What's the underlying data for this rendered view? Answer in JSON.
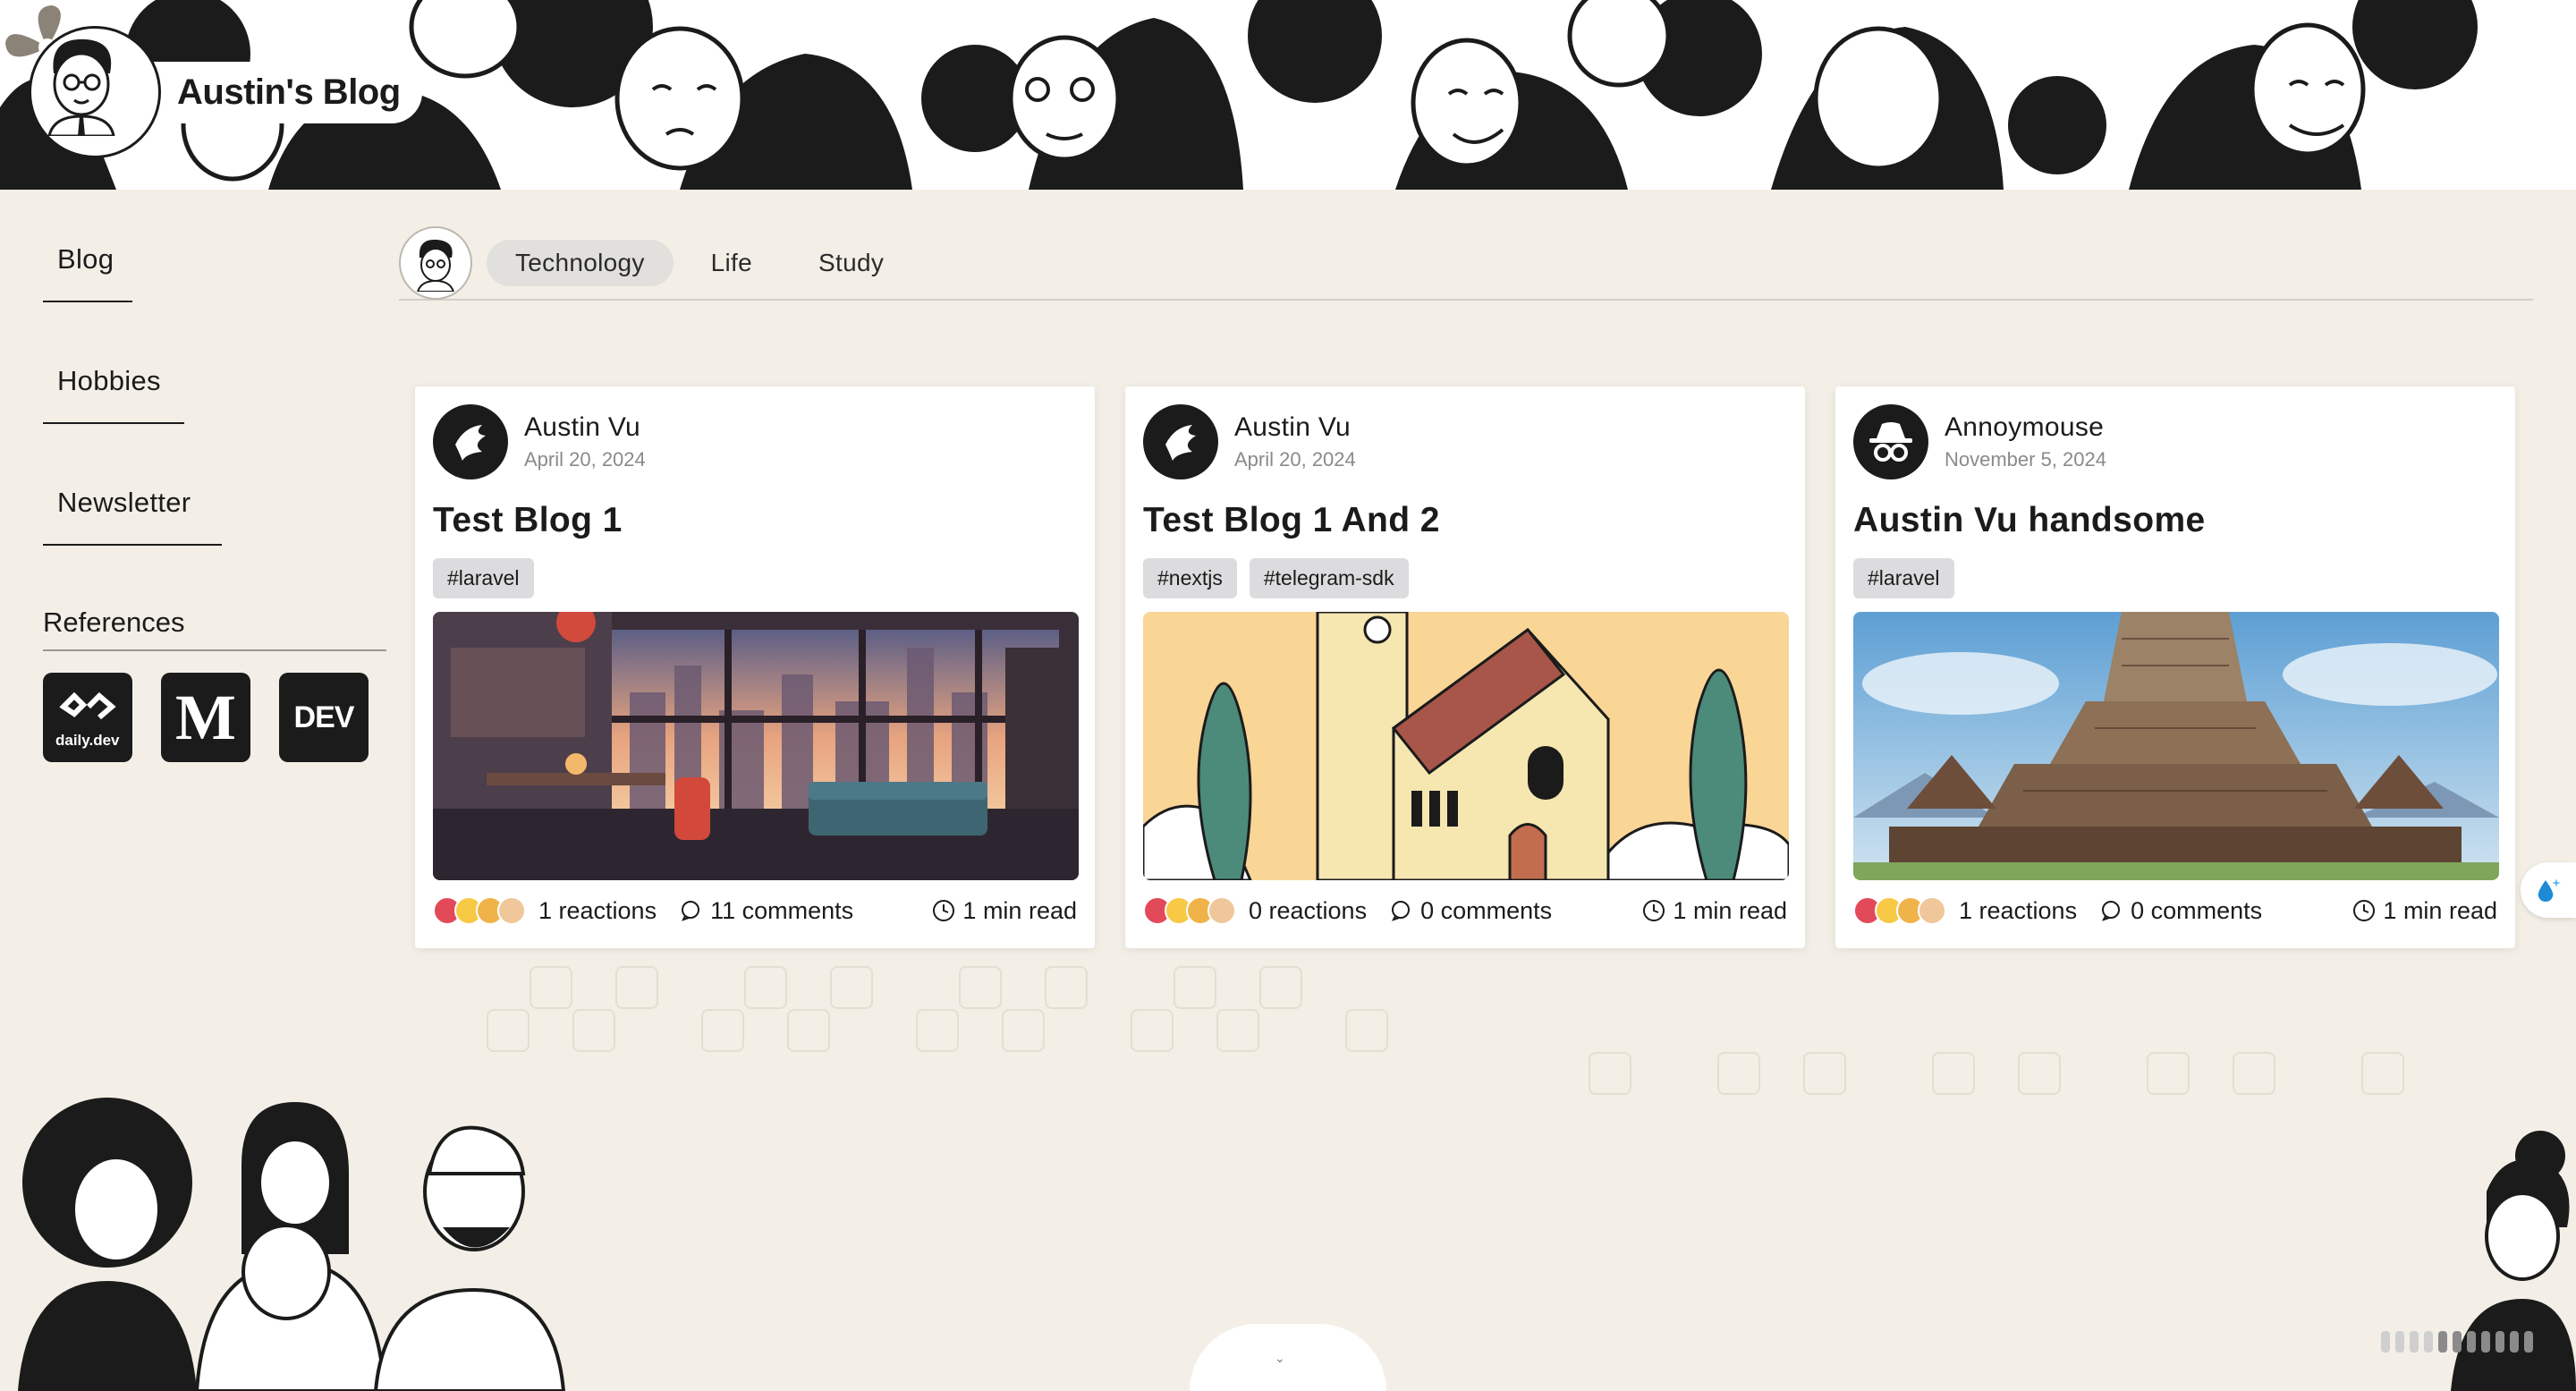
{
  "brand": {
    "title": "Austin's Blog"
  },
  "sidebar": {
    "items": [
      {
        "label": "Blog"
      },
      {
        "label": "Hobbies"
      },
      {
        "label": "Newsletter"
      }
    ],
    "references_title": "References",
    "references": [
      {
        "name": "daily.dev",
        "icon": "daily-dev-icon",
        "caption": "daily.dev"
      },
      {
        "name": "Medium",
        "icon": "medium-icon",
        "caption": "M"
      },
      {
        "name": "DEV",
        "icon": "dev-icon",
        "caption": "DEV"
      }
    ]
  },
  "tabs": [
    {
      "label": "Technology",
      "active": true
    },
    {
      "label": "Life",
      "active": false
    },
    {
      "label": "Study",
      "active": false
    }
  ],
  "posts": [
    {
      "author": "Austin Vu",
      "date": "April 20, 2024",
      "title": "Test Blog 1",
      "tags": [
        "#laravel"
      ],
      "reactions": "1 reactions",
      "comments": "11 comments",
      "read_time": "1 min read",
      "thumbnail": "lofi-room"
    },
    {
      "author": "Austin Vu",
      "date": "April 20, 2024",
      "title": "Test Blog 1 And 2",
      "tags": [
        "#nextjs",
        "#telegram-sdk"
      ],
      "reactions": "0 reactions",
      "comments": "0 comments",
      "read_time": "1 min read",
      "thumbnail": "church"
    },
    {
      "author": "Annoymouse",
      "date": "November 5, 2024",
      "title": "Austin Vu handsome",
      "tags": [
        "#laravel"
      ],
      "reactions": "1 reactions",
      "comments": "0 comments",
      "read_time": "1 min read",
      "thumbnail": "temple"
    }
  ],
  "colors": {
    "background": "#f3efe6",
    "card": "#ffffff",
    "tag_bg": "#dcdcde",
    "active_tab": "#e2e0dd",
    "text": "#1b1b1b",
    "muted": "#8a8a8a"
  }
}
